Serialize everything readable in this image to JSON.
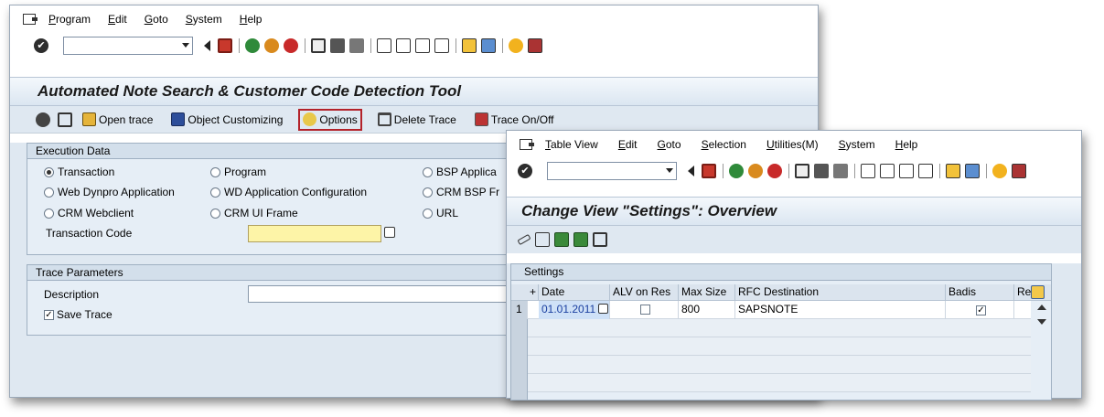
{
  "w1": {
    "menu": [
      "Program",
      "Edit",
      "Goto",
      "System",
      "Help"
    ],
    "title": "Automated Note Search & Customer Code Detection Tool",
    "toolbar": {
      "open_trace": "Open trace",
      "object_customizing": "Object Customizing",
      "options": "Options",
      "delete_trace": "Delete Trace",
      "trace_onoff": "Trace On/Off"
    },
    "exec": {
      "header": "Execution Data",
      "radios": [
        "Transaction",
        "Program",
        "BSP Applica",
        "Web Dynpro Application",
        "WD Application Configuration",
        "CRM BSP Fr",
        "CRM Webclient",
        "CRM UI Frame",
        "URL"
      ],
      "tcode_label": "Transaction Code"
    },
    "trace": {
      "header": "Trace Parameters",
      "description_label": "Description",
      "save_trace": "Save Trace"
    }
  },
  "w2": {
    "menu": [
      "Table View",
      "Edit",
      "Goto",
      "Selection",
      "Utilities(M)",
      "System",
      "Help"
    ],
    "title": "Change View \"Settings\": Overview",
    "table": {
      "title": "Settings",
      "columns": [
        "Date",
        "ALV on Res",
        "Max Size",
        "RFC Destination",
        "Badis",
        "Rep"
      ],
      "row": {
        "num": "1",
        "date": "01.01.2011",
        "max_size": "800",
        "rfc": "SAPSNOTE"
      }
    }
  }
}
